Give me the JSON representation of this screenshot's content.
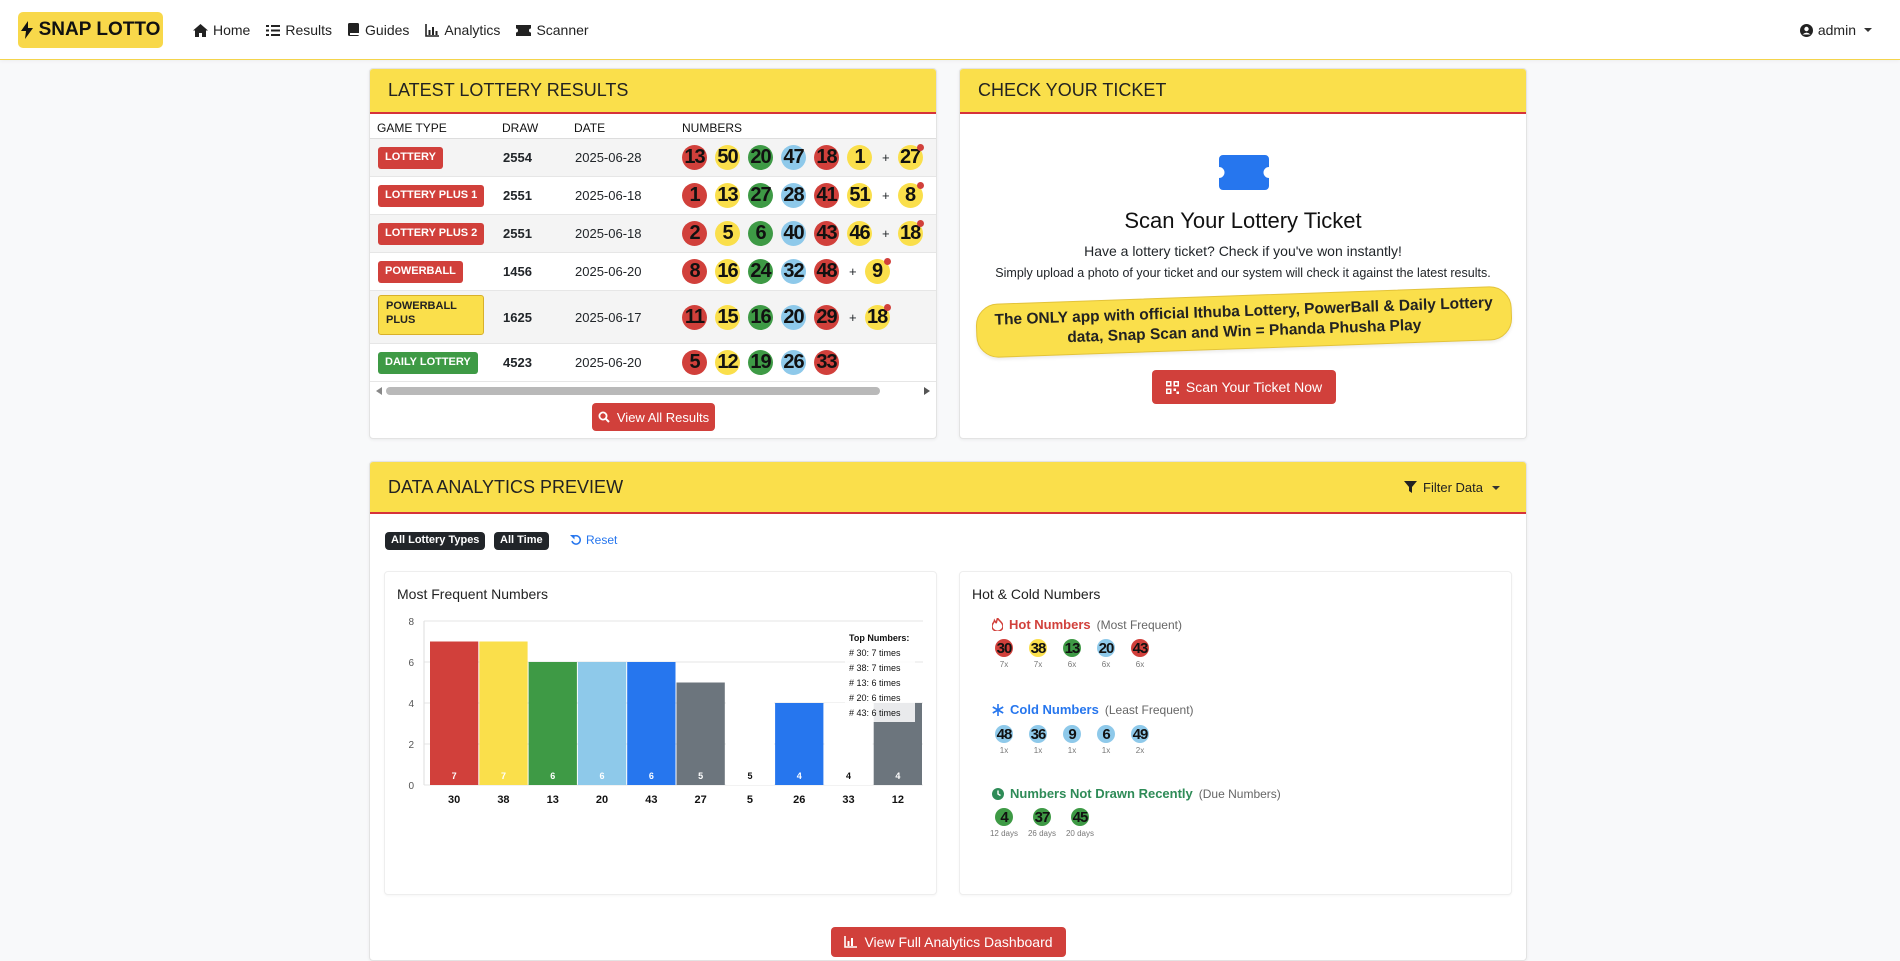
{
  "brand": {
    "name": "SNAP LOTTO"
  },
  "nav": [
    {
      "label": "Home",
      "icon": "home-icon"
    },
    {
      "label": "Results",
      "icon": "list-icon"
    },
    {
      "label": "Guides",
      "icon": "book-icon"
    },
    {
      "label": "Analytics",
      "icon": "chart-icon"
    },
    {
      "label": "Scanner",
      "icon": "ticket-icon"
    }
  ],
  "user": {
    "name": "admin"
  },
  "results": {
    "title": "LATEST LOTTERY RESULTS",
    "columns": [
      "GAME TYPE",
      "DRAW",
      "DATE",
      "NUMBERS"
    ],
    "rows": [
      {
        "game": "LOTTERY",
        "draw": "2554",
        "date": "2025-06-28",
        "badge": "red",
        "numbers": [
          {
            "n": "13",
            "c": "red"
          },
          {
            "n": "50",
            "c": "yellow"
          },
          {
            "n": "20",
            "c": "green"
          },
          {
            "n": "47",
            "c": "blue"
          },
          {
            "n": "18",
            "c": "red"
          },
          {
            "n": "1",
            "c": "yellow"
          }
        ],
        "bonus": {
          "n": "27",
          "c": "yellow"
        }
      },
      {
        "game": "LOTTERY PLUS 1",
        "draw": "2551",
        "date": "2025-06-18",
        "badge": "red",
        "numbers": [
          {
            "n": "1",
            "c": "red"
          },
          {
            "n": "13",
            "c": "yellow"
          },
          {
            "n": "27",
            "c": "green"
          },
          {
            "n": "28",
            "c": "blue"
          },
          {
            "n": "41",
            "c": "red"
          },
          {
            "n": "51",
            "c": "yellow"
          }
        ],
        "bonus": {
          "n": "8",
          "c": "yellow"
        }
      },
      {
        "game": "LOTTERY PLUS 2",
        "draw": "2551",
        "date": "2025-06-18",
        "badge": "red",
        "numbers": [
          {
            "n": "2",
            "c": "red"
          },
          {
            "n": "5",
            "c": "yellow"
          },
          {
            "n": "6",
            "c": "green"
          },
          {
            "n": "40",
            "c": "blue"
          },
          {
            "n": "43",
            "c": "red"
          },
          {
            "n": "46",
            "c": "yellow"
          }
        ],
        "bonus": {
          "n": "18",
          "c": "yellow"
        }
      },
      {
        "game": "POWERBALL",
        "draw": "1456",
        "date": "2025-06-20",
        "badge": "red",
        "numbers": [
          {
            "n": "8",
            "c": "red"
          },
          {
            "n": "16",
            "c": "yellow"
          },
          {
            "n": "24",
            "c": "green"
          },
          {
            "n": "32",
            "c": "blue"
          },
          {
            "n": "48",
            "c": "red"
          }
        ],
        "bonus": {
          "n": "9",
          "c": "yellow"
        }
      },
      {
        "game": "POWERBALL PLUS",
        "draw": "1625",
        "date": "2025-06-17",
        "badge": "yellow",
        "numbers": [
          {
            "n": "11",
            "c": "red"
          },
          {
            "n": "15",
            "c": "yellow"
          },
          {
            "n": "16",
            "c": "green"
          },
          {
            "n": "20",
            "c": "blue"
          },
          {
            "n": "29",
            "c": "red"
          }
        ],
        "bonus": {
          "n": "18",
          "c": "yellow"
        }
      },
      {
        "game": "DAILY LOTTERY",
        "draw": "4523",
        "date": "2025-06-20",
        "badge": "green",
        "numbers": [
          {
            "n": "5",
            "c": "red"
          },
          {
            "n": "12",
            "c": "yellow"
          },
          {
            "n": "19",
            "c": "green"
          },
          {
            "n": "26",
            "c": "blue"
          },
          {
            "n": "33",
            "c": "red"
          }
        ],
        "bonus": null
      }
    ],
    "plus_sign": "+",
    "view_all_label": "View All Results"
  },
  "ticket": {
    "title": "CHECK YOUR TICKET",
    "heading": "Scan Your Lottery Ticket",
    "line1": "Have a lottery ticket? Check if you've won instantly!",
    "line2": "Simply upload a photo of your ticket and our system will check it against the latest results.",
    "promo": "The ONLY app with official Ithuba Lottery, PowerBall & Daily Lottery data, Snap Scan and Win = Phanda Phusha Play",
    "button_label": "Scan Your Ticket Now"
  },
  "analytics": {
    "title": "DATA ANALYTICS PREVIEW",
    "filter_label": "Filter Data",
    "chips": [
      "All Lottery Types",
      "All Time"
    ],
    "reset_label": "Reset",
    "frequent_title": "Most Frequent Numbers",
    "hotcold_title": "Hot & Cold Numbers",
    "hot": {
      "label": "Hot Numbers",
      "note": "(Most Frequent)",
      "items": [
        {
          "n": "30",
          "c": "red",
          "t": "7x"
        },
        {
          "n": "38",
          "c": "yellow",
          "t": "7x"
        },
        {
          "n": "13",
          "c": "green",
          "t": "6x"
        },
        {
          "n": "20",
          "c": "blue",
          "t": "6x"
        },
        {
          "n": "43",
          "c": "red",
          "t": "6x"
        }
      ]
    },
    "cold": {
      "label": "Cold Numbers",
      "note": "(Least Frequent)",
      "items": [
        {
          "n": "48",
          "c": "blue",
          "t": "1x"
        },
        {
          "n": "36",
          "c": "blue",
          "t": "1x"
        },
        {
          "n": "9",
          "c": "blue",
          "t": "1x"
        },
        {
          "n": "6",
          "c": "blue",
          "t": "1x"
        },
        {
          "n": "49",
          "c": "blue",
          "t": "2x"
        }
      ]
    },
    "due": {
      "label": "Numbers Not Drawn Recently",
      "note": "(Due Numbers)",
      "items": [
        {
          "n": "4",
          "c": "green",
          "t": "12 days"
        },
        {
          "n": "37",
          "c": "green",
          "t": "26 days"
        },
        {
          "n": "45",
          "c": "green",
          "t": "20 days"
        }
      ]
    },
    "dashboard_label": "View Full Analytics Dashboard"
  },
  "colors": {
    "red": "#d1403b",
    "yellow": "#fadf4b",
    "green": "#3e9a45",
    "blue": "#8ec9ea",
    "brightblue": "#2676ee",
    "gray": "#6c757d",
    "white": "#ffffff"
  },
  "chart_data": {
    "type": "bar",
    "title": "Most Frequent Numbers",
    "categories": [
      "30",
      "38",
      "13",
      "20",
      "43",
      "27",
      "5",
      "26",
      "33",
      "12"
    ],
    "values": [
      7,
      7,
      6,
      6,
      6,
      5,
      5,
      4,
      4,
      4
    ],
    "bar_colors": [
      "#d1403b",
      "#fadf4b",
      "#3e9a45",
      "#8ec9ea",
      "#2676ee",
      "#6c757d",
      "#ffffff",
      "#2676ee",
      "#ffffff",
      "#6c757d"
    ],
    "ylim": [
      0,
      8
    ],
    "yticks": [
      0,
      2,
      4,
      6,
      8
    ],
    "grid": true,
    "legend": {
      "title": "Top Numbers:",
      "items": [
        "# 30: 7 times",
        "# 38: 7 times",
        "# 13: 6 times",
        "# 20: 6 times",
        "# 43: 6 times"
      ],
      "placement": "top-right"
    }
  }
}
